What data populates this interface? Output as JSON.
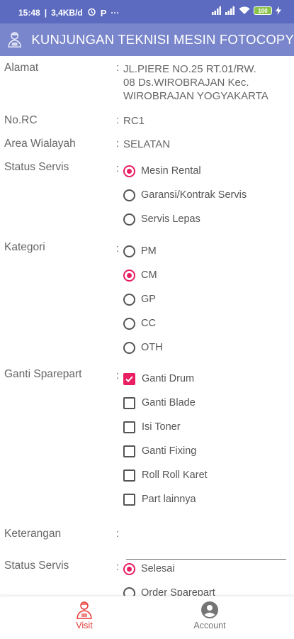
{
  "status_bar": {
    "time": "15:48",
    "speed": "3,4KB/d",
    "more": "···",
    "battery": "100"
  },
  "app_bar": {
    "title": "KUNJUNGAN TEKNISI MESIN FOTOCOPY",
    "logo_icon": "technician-logo-icon"
  },
  "form": {
    "alamat": {
      "label": "Alamat",
      "colon": ":",
      "lines": [
        "JL.PIERE NO.25 RT.01/RW.",
        "08 Ds.WIROBRAJAN Kec.",
        "WIROBRAJAN YOGYAKARTA"
      ]
    },
    "no_rc": {
      "label": "No.RC",
      "colon": ":",
      "value": "RC1"
    },
    "area": {
      "label": "Area Wialayah",
      "colon": ":",
      "value": "SELATAN"
    },
    "status_servis": {
      "label": "Status Servis",
      "colon": ":",
      "options": [
        "Mesin Rental",
        "Garansi/Kontrak Servis",
        "Servis Lepas"
      ],
      "selected": "Mesin Rental"
    },
    "kategori": {
      "label": "Kategori",
      "colon": ":",
      "options": [
        "PM",
        "CM",
        "GP",
        "CC",
        "OTH"
      ],
      "selected": "CM"
    },
    "ganti_sparepart": {
      "label": "Ganti Sparepart",
      "colon": ":",
      "options": [
        "Ganti Drum",
        "Ganti Blade",
        "Isi Toner",
        "Ganti Fixing",
        "Roll Roll Karet",
        "Part lainnya"
      ],
      "checked": [
        "Ganti Drum"
      ]
    },
    "keterangan": {
      "label": "Keterangan",
      "colon": ":",
      "value": ""
    },
    "status_servis_2": {
      "label": "Status Servis",
      "colon": ":",
      "options": [
        "Selesai",
        "Order Sparepart"
      ],
      "selected": "Selesai"
    }
  },
  "bottom_nav": {
    "items": [
      {
        "label": "Visit",
        "icon": "technician-icon",
        "active": true
      },
      {
        "label": "Account",
        "icon": "account-circle-icon",
        "active": false
      }
    ]
  },
  "colors": {
    "status_bar": "#5c6bc0",
    "app_bar": "#7986cb",
    "accent": "#e91e63"
  }
}
